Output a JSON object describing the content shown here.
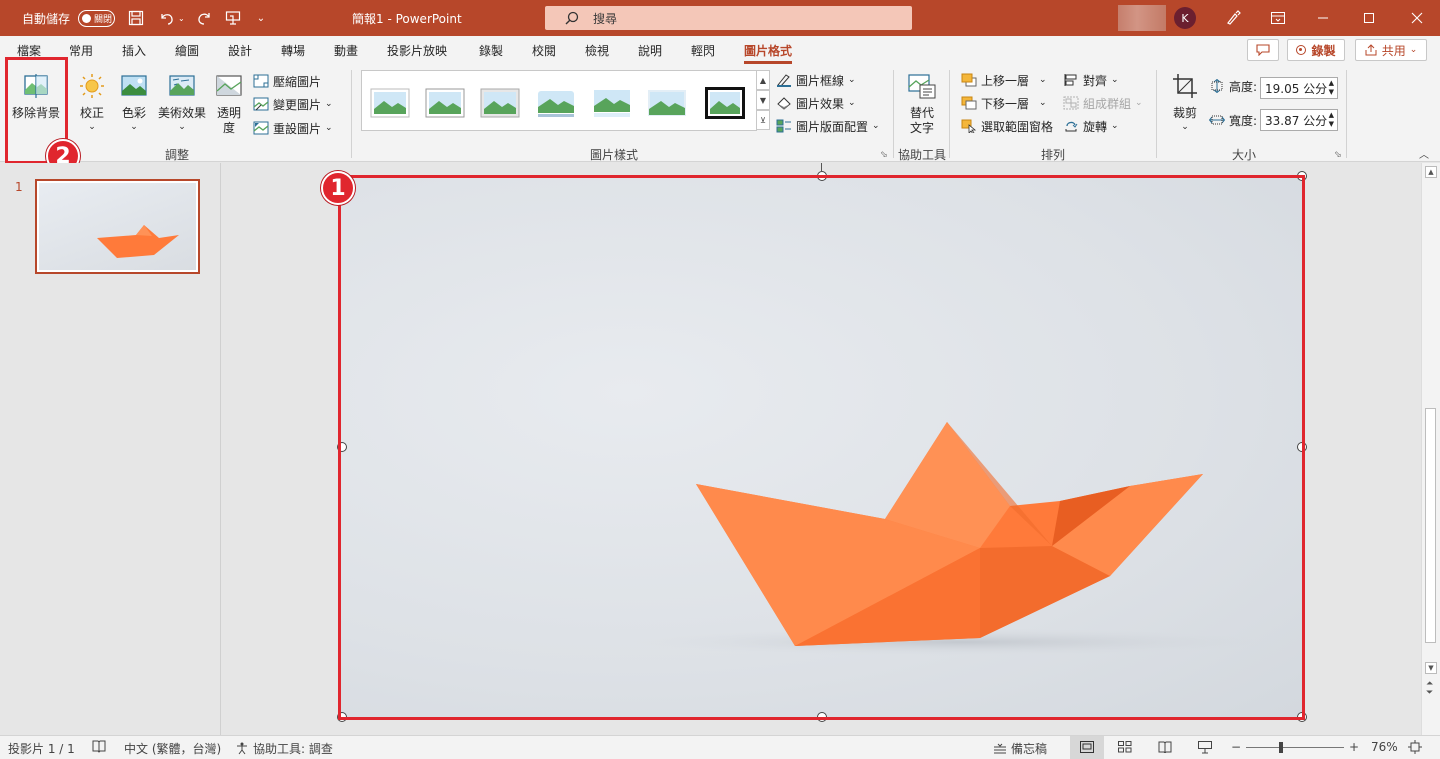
{
  "titlebar": {
    "autosave_label": "自動儲存",
    "autosave_state": "關閉",
    "doc_title": "簡報1 - PowerPoint",
    "search_placeholder": "搜尋",
    "avatar_initial": "K",
    "accent_color": "#b7472a"
  },
  "tabs": [
    {
      "label": "檔案"
    },
    {
      "label": "常用"
    },
    {
      "label": "插入"
    },
    {
      "label": "繪圖"
    },
    {
      "label": "設計"
    },
    {
      "label": "轉場"
    },
    {
      "label": "動畫"
    },
    {
      "label": "投影片放映"
    },
    {
      "label": "錄製"
    },
    {
      "label": "校閱"
    },
    {
      "label": "檢視"
    },
    {
      "label": "說明"
    },
    {
      "label": "輕閃"
    },
    {
      "label": "圖片格式",
      "active": true
    }
  ],
  "tab_actions": {
    "record_label": "錄製",
    "share_label": "共用"
  },
  "ribbon": {
    "adjust": {
      "group_label": "調整",
      "remove_bg": "移除背景",
      "corrections": "校正",
      "color": "色彩",
      "artistic": "美術效果",
      "transparency_1": "透明",
      "transparency_2": "度",
      "compress": "壓縮圖片",
      "change": "變更圖片",
      "reset": "重設圖片"
    },
    "styles": {
      "group_label": "圖片樣式",
      "border": "圖片框線",
      "effects": "圖片效果",
      "layout": "圖片版面配置"
    },
    "accessibility": {
      "group_label": "協助工具",
      "alt_text_1": "替代",
      "alt_text_2": "文字"
    },
    "arrange": {
      "group_label": "排列",
      "bring_forward": "上移一層",
      "send_backward": "下移一層",
      "selection_pane": "選取範圍窗格",
      "align": "對齊",
      "group": "組成群組",
      "rotate": "旋轉"
    },
    "size": {
      "group_label": "大小",
      "crop": "裁剪",
      "height_label": "高度:",
      "height_value": "19.05 公分",
      "width_label": "寬度:",
      "width_value": "33.87 公分"
    }
  },
  "slides": {
    "current_number": "1"
  },
  "annotations": {
    "badge_1": "1",
    "badge_2": "2",
    "highlight_color": "#e0262e"
  },
  "statusbar": {
    "slide_info": "投影片 1 / 1",
    "language": "中文 (繁體，台灣)",
    "accessibility": "協助工具: 調查",
    "notes": "備忘稿",
    "zoom": "76%"
  }
}
